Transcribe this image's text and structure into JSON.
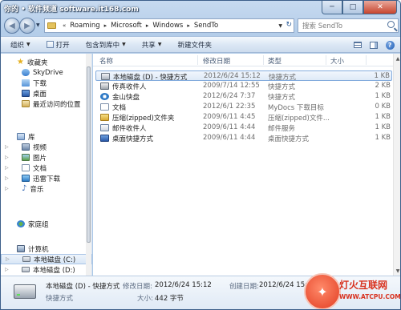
{
  "watermark_top": "你的 • 软件频道 software.it168.com",
  "window_controls": {
    "minimize": "─",
    "maximize": "□",
    "close": "✕"
  },
  "nav": {
    "back": "◀",
    "forward": "▶",
    "dropdown": "▼"
  },
  "address": {
    "prefix_sep": "«",
    "crumbs": [
      "Roaming",
      "Microsoft",
      "Windows",
      "SendTo"
    ],
    "sep": "▸",
    "dropdown": "▼",
    "refresh": "↻"
  },
  "search": {
    "placeholder": "搜索 SendTo"
  },
  "toolbar": {
    "organize": "组织",
    "open": "打开",
    "include_in_library": "包含到库中",
    "share": "共享",
    "new_folder": "新建文件夹",
    "arrow": "▼",
    "help": "?"
  },
  "sidebar": {
    "favorites": {
      "label": "收藏夹",
      "items": [
        "SkyDrive",
        "下载",
        "桌面",
        "最近访问的位置"
      ]
    },
    "libraries": {
      "label": "库",
      "items": [
        "视频",
        "图片",
        "文档",
        "迅雷下载",
        "音乐"
      ]
    },
    "homegroup": {
      "label": "家庭组"
    },
    "computer": {
      "label": "计算机",
      "items": [
        "本地磁盘 (C:)",
        "本地磁盘 (D:)"
      ]
    }
  },
  "columns": {
    "name": "名称",
    "date": "修改日期",
    "type": "类型",
    "size": "大小"
  },
  "files": [
    {
      "name": "本地磁盘 (D) - 快捷方式",
      "date": "2012/6/24 15:12",
      "type": "快捷方式",
      "size": "1 KB",
      "icon": "drive-icon"
    },
    {
      "name": "传真收件人",
      "date": "2009/7/14 12:55",
      "type": "快捷方式",
      "size": "2 KB",
      "icon": "fax-icon"
    },
    {
      "name": "金山快盘",
      "date": "2012/6/24 7:37",
      "type": "快捷方式",
      "size": "1 KB",
      "icon": "kingsoft-icon"
    },
    {
      "name": "文档",
      "date": "2012/6/1 22:35",
      "type": "MyDocs 下载目标",
      "size": "0 KB",
      "icon": "document-icon"
    },
    {
      "name": "压缩(zipped)文件夹",
      "date": "2009/6/11 4:45",
      "type": "压缩(zipped)文件...",
      "size": "1 KB",
      "icon": "zip-folder-icon"
    },
    {
      "name": "邮件收件人",
      "date": "2009/6/11 4:44",
      "type": "邮件服务",
      "size": "1 KB",
      "icon": "mail-icon"
    },
    {
      "name": "桌面快捷方式",
      "date": "2009/6/11 4:44",
      "type": "桌面快捷方式",
      "size": "1 KB",
      "icon": "desktop-icon"
    }
  ],
  "details": {
    "name": "本地磁盘 (D) - 快捷方式",
    "type": "快捷方式",
    "modified_label": "修改日期:",
    "modified_value": "2012/6/24 15:12",
    "created_label": "创建日期:",
    "created_value": "2012/6/24 15:12",
    "size_label": "大小:",
    "size_value": "442 字节"
  },
  "watermark_badge": {
    "title": "灯火互联网",
    "url": "WWW.ATCPU.COM",
    "glyph": "✦"
  },
  "colors": {
    "selection": "#dde9f7",
    "selection_border": "#84acdd",
    "frame": "#b4cde9"
  }
}
